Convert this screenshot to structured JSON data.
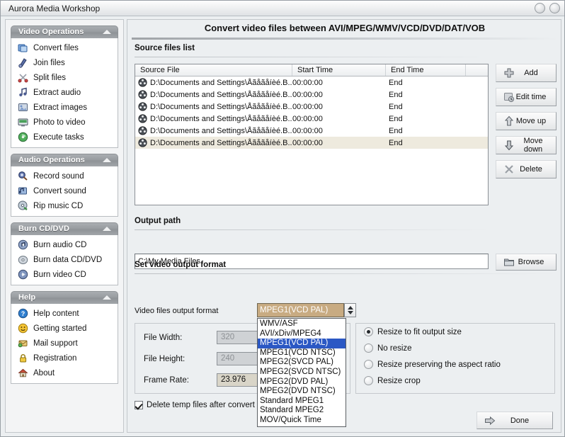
{
  "window": {
    "title": "Aurora Media Workshop",
    "buttons": [
      {
        "name": "minimize-button",
        "label": ""
      },
      {
        "name": "maximize-button",
        "label": ""
      }
    ]
  },
  "sidebar": {
    "panels": [
      {
        "title": "Video Operations",
        "collapse_icon": "chevron-up-icon",
        "items": [
          {
            "label": "Convert files",
            "icon": "convert-files-icon"
          },
          {
            "label": "Join files",
            "icon": "join-files-icon"
          },
          {
            "label": "Split files",
            "icon": "scissors-icon"
          },
          {
            "label": "Extract audio",
            "icon": "music-note-icon"
          },
          {
            "label": "Extract images",
            "icon": "image-icon"
          },
          {
            "label": "Photo to video",
            "icon": "monitor-icon"
          },
          {
            "label": "Execute tasks",
            "icon": "play-disc-icon"
          }
        ]
      },
      {
        "title": "Audio Operations",
        "collapse_icon": "chevron-up-icon",
        "items": [
          {
            "label": "Record sound",
            "icon": "microphone-icon"
          },
          {
            "label": "Convert sound",
            "icon": "convert-sound-icon"
          },
          {
            "label": "Rip music CD",
            "icon": "rip-cd-icon"
          }
        ]
      },
      {
        "title": "Burn CD/DVD",
        "collapse_icon": "chevron-up-icon",
        "items": [
          {
            "label": "Burn audio CD",
            "icon": "audio-cd-icon"
          },
          {
            "label": "Burn data CD/DVD",
            "icon": "data-disc-icon"
          },
          {
            "label": "Burn video CD",
            "icon": "video-cd-icon"
          }
        ]
      },
      {
        "title": "Help",
        "collapse_icon": "chevron-up-icon",
        "items": [
          {
            "label": "Help content",
            "icon": "question-mark-icon"
          },
          {
            "label": "Getting started",
            "icon": "smiley-face-icon"
          },
          {
            "label": "Mail support",
            "icon": "mail-icon"
          },
          {
            "label": "Registration",
            "icon": "lock-icon"
          },
          {
            "label": "About",
            "icon": "home-icon"
          }
        ]
      }
    ]
  },
  "main": {
    "page_title": "Convert video files between AVI/MPEG/WMV/VCD/DVD/DAT/VOB",
    "source_files": {
      "section_label": "Source files list",
      "columns": [
        "Source File",
        "Start Time",
        "End Time",
        ""
      ],
      "rows": [
        {
          "file": "D:\\Documents and Settings\\Åãåãåíèé.B...",
          "start": "00:00:00",
          "end": "End",
          "selected": false
        },
        {
          "file": "D:\\Documents and Settings\\Åãåãåíèé.B...",
          "start": "00:00:00",
          "end": "End",
          "selected": false
        },
        {
          "file": "D:\\Documents and Settings\\Åãåãåíèé.B...",
          "start": "00:00:00",
          "end": "End",
          "selected": false
        },
        {
          "file": "D:\\Documents and Settings\\Åãåãåíèé.B...",
          "start": "00:00:00",
          "end": "End",
          "selected": false
        },
        {
          "file": "D:\\Documents and Settings\\Åãåãåíèé.B...",
          "start": "00:00:00",
          "end": "End",
          "selected": false
        },
        {
          "file": "D:\\Documents and Settings\\Åãåãåíèé.B...",
          "start": "00:00:00",
          "end": "End",
          "selected": true
        }
      ],
      "actions": [
        {
          "label": "Add",
          "icon": "plus-icon"
        },
        {
          "label": "Edit time",
          "icon": "clock-icon"
        },
        {
          "label": "Move up",
          "icon": "arrow-up-icon"
        },
        {
          "label": "Move down",
          "icon": "arrow-down-icon"
        },
        {
          "label": "Delete",
          "icon": "x-icon"
        }
      ]
    },
    "output_path": {
      "section_label": "Output path",
      "value": "C:\\My Media Files",
      "browse": {
        "label": "Browse",
        "icon": "folder-icon"
      }
    },
    "video_format": {
      "section_label": "Set video output format",
      "format_label": "Video files output format",
      "selected_format": "MPEG1(VCD PAL)",
      "options": [
        "WMV/ASF",
        "AVI/xDiv/MPEG4",
        "MPEG1(VCD PAL)",
        "MPEG1(VCD NTSC)",
        "MPEG2(SVCD PAL)",
        "MPEG2(SVCD NTSC)",
        "MPEG2(DVD PAL)",
        "MPEG2(DVD NTSC)",
        "Standard MPEG1",
        "Standard MPEG2",
        "MOV/Quick Time"
      ],
      "fields": [
        {
          "label": "File Width:",
          "value": "320",
          "disabled": true
        },
        {
          "label": "File Height:",
          "value": "240",
          "disabled": true
        },
        {
          "label": "Frame Rate:",
          "value": "23.976",
          "disabled": false
        }
      ],
      "delete_temp": {
        "label": "Delete temp files after convert",
        "checked": true
      },
      "resize_options": [
        {
          "label": "Resize to fit output size",
          "selected": true
        },
        {
          "label": "No resize",
          "selected": false
        },
        {
          "label": "Resize preserving the aspect ratio",
          "selected": false
        },
        {
          "label": "Resize crop",
          "selected": false
        }
      ]
    },
    "done_button": {
      "label": "Done",
      "icon": "arrow-right-icon"
    }
  },
  "colors": {
    "accent": "#2b58c4",
    "combo_bg": "#c8ab82",
    "selected_row": "#eeeade",
    "panel_header": "#979b9f"
  }
}
